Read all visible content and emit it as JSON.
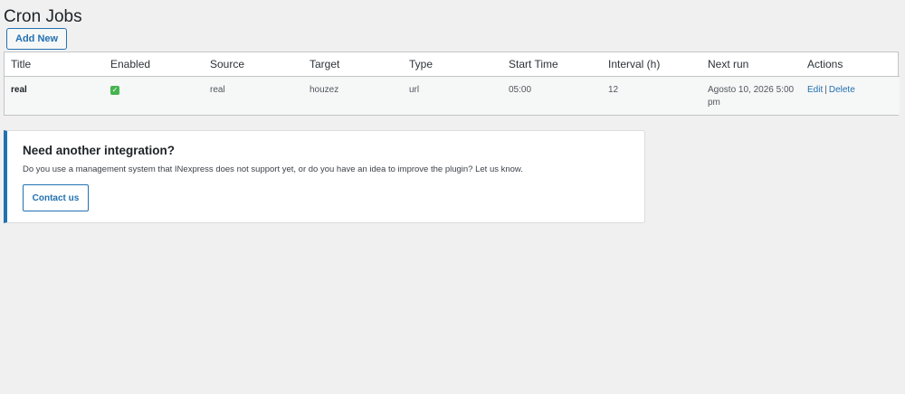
{
  "page": {
    "title": "Cron Jobs",
    "add_new_label": "Add New"
  },
  "table": {
    "headers": [
      "Title",
      "Enabled",
      "Source",
      "Target",
      "Type",
      "Start Time",
      "Interval (h)",
      "Next run",
      "Actions"
    ],
    "rows": [
      {
        "title": "real",
        "enabled_icon": "checkbox-checked-icon",
        "source": "real",
        "target": "houzez",
        "type": "url",
        "start_time": "05:00",
        "interval": "12",
        "next_run": "Agosto 10, 2026 5:00 pm",
        "edit_label": "Edit",
        "separator": "|",
        "delete_label": "Delete"
      }
    ]
  },
  "notice": {
    "title": "Need another integration?",
    "text": "Do you use a management system that INexpress does not support yet, or do you have an idea to improve the plugin? Let us know.",
    "button_label": "Contact us"
  },
  "colors": {
    "accent": "#2271b1",
    "check": "#46b450",
    "background": "#f0f0f1"
  }
}
